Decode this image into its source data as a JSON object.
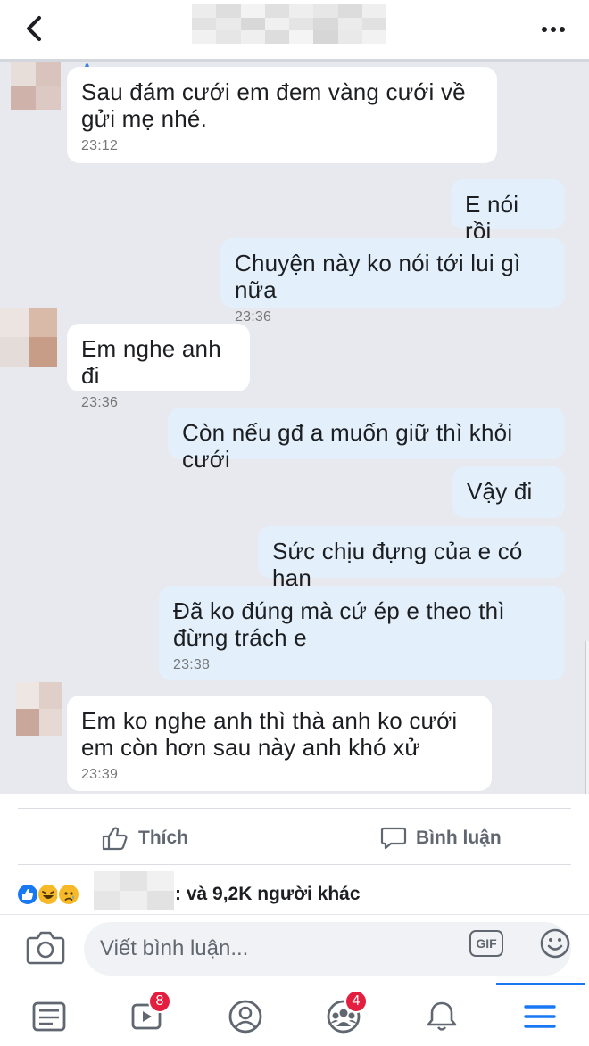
{
  "top_bar": {
    "back_icon": "chevron-left-icon",
    "more_icon": "more-horizontal-icon"
  },
  "messages": [
    {
      "side": "in",
      "text": "Sau đám cưới em đem vàng cưới về gửi mẹ nhé.",
      "time": "23:12"
    },
    {
      "side": "out",
      "text": "E nói rồi",
      "time": ""
    },
    {
      "side": "out",
      "text": "Chuyện này ko nói tới lui gì nữa",
      "time": "23:36"
    },
    {
      "side": "in",
      "text": "Em nghe anh đi",
      "time": "23:36"
    },
    {
      "side": "out",
      "text": "Còn nếu gđ a muốn giữ thì khỏi cưới",
      "time": ""
    },
    {
      "side": "out",
      "text": "Vậy đi",
      "time": ""
    },
    {
      "side": "out",
      "text": "Sức chịu đựng của e có hạn",
      "time": ""
    },
    {
      "side": "out",
      "text": "Đã ko đúng mà cứ ép e theo thì đừng trách e",
      "time": "23:38"
    },
    {
      "side": "in",
      "text": "Em ko nghe anh thì thà anh ko cưới em còn hơn sau này anh khó xử",
      "time": "23:39"
    }
  ],
  "actions": {
    "like_label": "Thích",
    "comment_label": "Bình luận"
  },
  "reactions": {
    "icons": [
      "like-reaction-icon",
      "haha-reaction-icon",
      "sad-reaction-icon"
    ],
    "others_text": ": và 9,2K người khác"
  },
  "comment_box": {
    "placeholder": "Viết bình luận...",
    "gif_label": "GIF"
  },
  "bottom_nav": {
    "watch_badge": "8",
    "groups_badge": "4"
  },
  "colors": {
    "accent": "#1877f2",
    "badge": "#e41e3f",
    "chat_background": "#e8e9ee",
    "outgoing_bubble": "#e3f0fb",
    "incoming_bubble": "#ffffff"
  }
}
